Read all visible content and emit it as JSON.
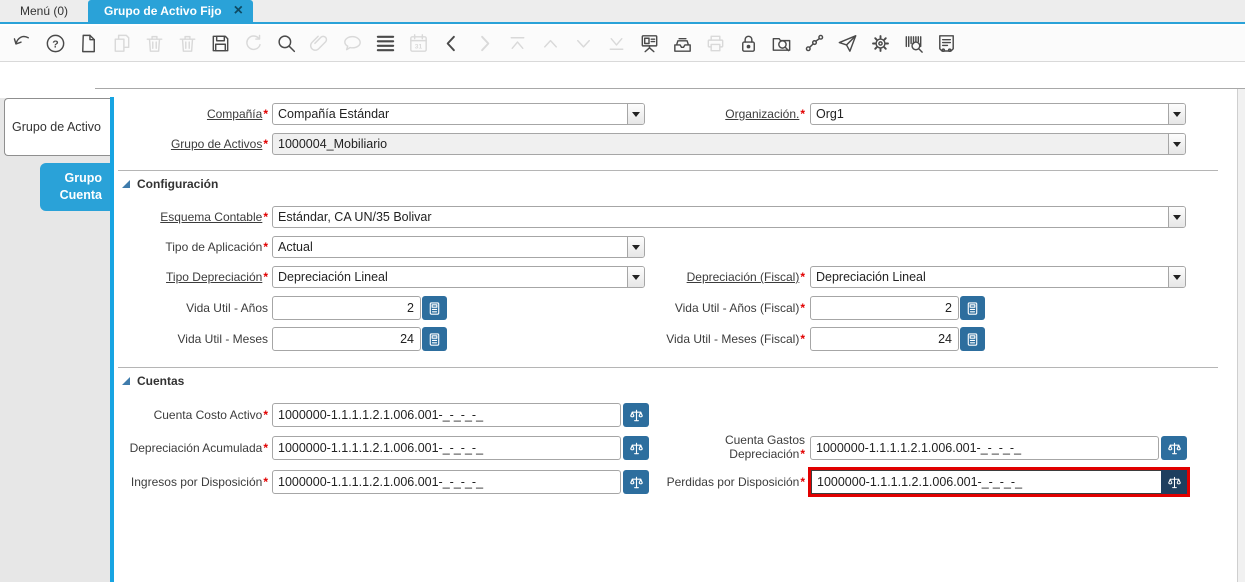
{
  "window_tabs": {
    "menu_tab": "Menú (0)",
    "active_tab": "Grupo de Activo Fijo",
    "close_glyph": "×"
  },
  "toolbar": {
    "help_glyph": "?",
    "calendar_glyph": "31",
    "icons": [
      {
        "name": "undo",
        "enabled": true
      },
      {
        "name": "help",
        "enabled": true
      },
      {
        "name": "new-record",
        "enabled": true
      },
      {
        "name": "copy-record",
        "enabled": false
      },
      {
        "name": "delete-record",
        "enabled": false
      },
      {
        "name": "delete-selection",
        "enabled": false
      },
      {
        "name": "save",
        "enabled": true
      },
      {
        "name": "refresh",
        "enabled": false
      },
      {
        "name": "find",
        "enabled": true
      },
      {
        "name": "attachment",
        "enabled": false
      },
      {
        "name": "chat",
        "enabled": false
      },
      {
        "name": "toggle-grid",
        "enabled": true
      },
      {
        "name": "calendar",
        "enabled": false
      },
      {
        "name": "previous-record",
        "enabled": true
      },
      {
        "name": "next-record",
        "enabled": false
      },
      {
        "name": "first-record",
        "enabled": false
      },
      {
        "name": "up-record",
        "enabled": false
      },
      {
        "name": "down-record",
        "enabled": false
      },
      {
        "name": "last-record",
        "enabled": false
      },
      {
        "name": "detail-window",
        "enabled": true
      },
      {
        "name": "archive",
        "enabled": true
      },
      {
        "name": "print",
        "enabled": false
      },
      {
        "name": "lock",
        "enabled": true
      },
      {
        "name": "zoom-across",
        "enabled": true
      },
      {
        "name": "workflow",
        "enabled": true
      },
      {
        "name": "send-mail",
        "enabled": true
      },
      {
        "name": "preferences",
        "enabled": true
      },
      {
        "name": "product-info",
        "enabled": true
      },
      {
        "name": "report",
        "enabled": true
      }
    ]
  },
  "sidebar": {
    "tabs": [
      {
        "label": "Grupo de Activo"
      },
      {
        "label": "Grupo Cuenta"
      }
    ]
  },
  "form": {
    "required_marker": "*",
    "sections": {
      "configuracion": "Configuración",
      "cuentas": "Cuentas"
    },
    "fields": {
      "compania": {
        "label": "Compañía",
        "value": "Compañía Estándar"
      },
      "organizacion": {
        "label": "Organización.",
        "value": "Org1"
      },
      "grupo_activos": {
        "label": "Grupo de Activos",
        "value": "1000004_Mobiliario"
      },
      "esquema_contable": {
        "label": "Esquema Contable",
        "value": "Estándar, CA UN/35 Bolivar"
      },
      "tipo_aplicacion": {
        "label": "Tipo de Aplicación",
        "value": "Actual"
      },
      "tipo_depreciacion": {
        "label": "Tipo Depreciación",
        "value": "Depreciación Lineal"
      },
      "depreciacion_fiscal": {
        "label": "Depreciación (Fiscal)",
        "value": "Depreciación Lineal"
      },
      "vida_util_anos": {
        "label": "Vida Util - Años",
        "value": "2"
      },
      "vida_util_anos_fiscal": {
        "label": "Vida Util - Años (Fiscal)",
        "value": "2"
      },
      "vida_util_meses": {
        "label": "Vida Util - Meses",
        "value": "24"
      },
      "vida_util_meses_fiscal": {
        "label": "Vida Util - Meses (Fiscal)",
        "value": "24"
      },
      "cuenta_costo_activo": {
        "label": "Cuenta Costo Activo",
        "value": "1000000-1.1.1.1.2.1.006.001-_-_-_-_"
      },
      "depreciacion_acumulada": {
        "label": "Depreciación Acumulada",
        "value": "1000000-1.1.1.1.2.1.006.001-_-_-_-_"
      },
      "cuenta_gastos_depreciacion": {
        "label": "Cuenta Gastos Depreciación",
        "value": "1000000-1.1.1.1.2.1.006.001-_-_-_-_"
      },
      "ingresos_disposicion": {
        "label": "Ingresos por Disposición",
        "value": "1000000-1.1.1.1.2.1.006.001-_-_-_-_"
      },
      "perdidas_disposicion": {
        "label": "Perdidas por Disposición",
        "value": "1000000-1.1.1.1.2.1.006.001-_-_-_-_",
        "highlighted": true
      }
    }
  },
  "colors": {
    "tab_blue": "#2aa2d8",
    "sidebar_bar_blue": "#17a4e2",
    "button_steel_blue": "#2d6e9e",
    "button_navy": "#1e3f5f",
    "highlight_red": "#e10000",
    "required_red": "#e10000"
  }
}
